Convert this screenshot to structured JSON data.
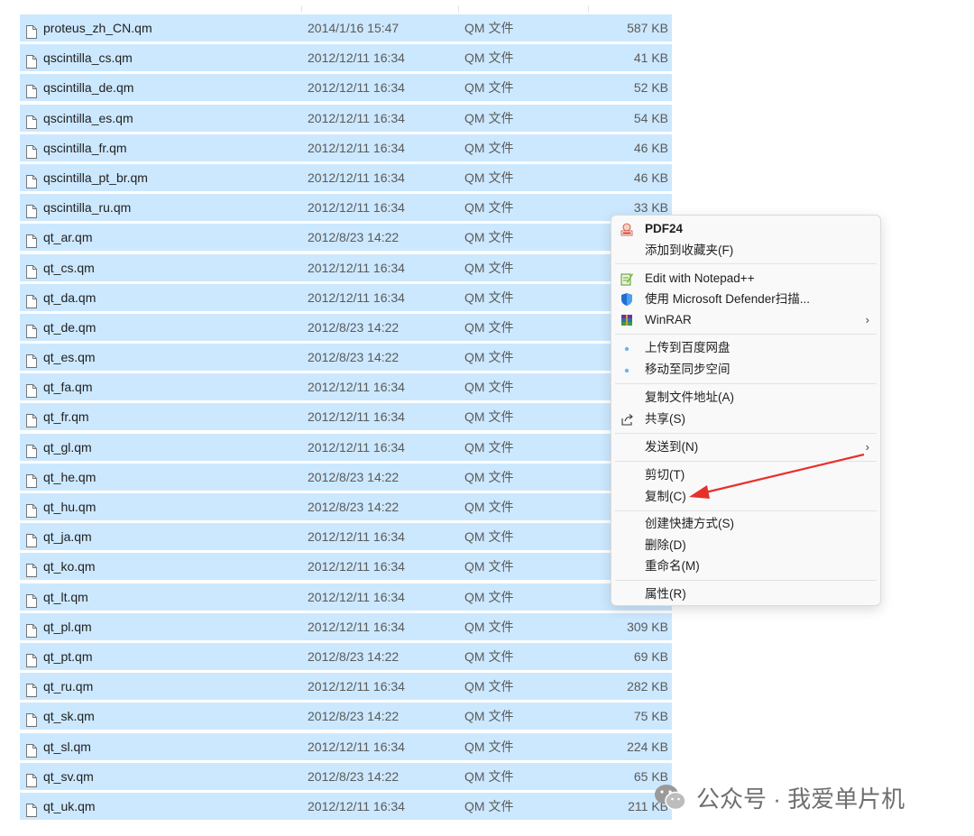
{
  "files": [
    {
      "name": "proteus_zh_CN.qm",
      "date": "2014/1/16 15:47",
      "type": "QM 文件",
      "size": "587 KB"
    },
    {
      "name": "qscintilla_cs.qm",
      "date": "2012/12/11 16:34",
      "type": "QM 文件",
      "size": "41 KB"
    },
    {
      "name": "qscintilla_de.qm",
      "date": "2012/12/11 16:34",
      "type": "QM 文件",
      "size": "52 KB"
    },
    {
      "name": "qscintilla_es.qm",
      "date": "2012/12/11 16:34",
      "type": "QM 文件",
      "size": "54 KB"
    },
    {
      "name": "qscintilla_fr.qm",
      "date": "2012/12/11 16:34",
      "type": "QM 文件",
      "size": "46 KB"
    },
    {
      "name": "qscintilla_pt_br.qm",
      "date": "2012/12/11 16:34",
      "type": "QM 文件",
      "size": "46 KB"
    },
    {
      "name": "qscintilla_ru.qm",
      "date": "2012/12/11 16:34",
      "type": "QM 文件",
      "size": "33 KB"
    },
    {
      "name": "qt_ar.qm",
      "date": "2012/8/23 14:22",
      "type": "QM 文件",
      "size": ""
    },
    {
      "name": "qt_cs.qm",
      "date": "2012/12/11 16:34",
      "type": "QM 文件",
      "size": ""
    },
    {
      "name": "qt_da.qm",
      "date": "2012/12/11 16:34",
      "type": "QM 文件",
      "size": ""
    },
    {
      "name": "qt_de.qm",
      "date": "2012/8/23 14:22",
      "type": "QM 文件",
      "size": ""
    },
    {
      "name": "qt_es.qm",
      "date": "2012/8/23 14:22",
      "type": "QM 文件",
      "size": ""
    },
    {
      "name": "qt_fa.qm",
      "date": "2012/12/11 16:34",
      "type": "QM 文件",
      "size": ""
    },
    {
      "name": "qt_fr.qm",
      "date": "2012/12/11 16:34",
      "type": "QM 文件",
      "size": ""
    },
    {
      "name": "qt_gl.qm",
      "date": "2012/12/11 16:34",
      "type": "QM 文件",
      "size": ""
    },
    {
      "name": "qt_he.qm",
      "date": "2012/8/23 14:22",
      "type": "QM 文件",
      "size": ""
    },
    {
      "name": "qt_hu.qm",
      "date": "2012/8/23 14:22",
      "type": "QM 文件",
      "size": ""
    },
    {
      "name": "qt_ja.qm",
      "date": "2012/12/11 16:34",
      "type": "QM 文件",
      "size": ""
    },
    {
      "name": "qt_ko.qm",
      "date": "2012/12/11 16:34",
      "type": "QM 文件",
      "size": ""
    },
    {
      "name": "qt_lt.qm",
      "date": "2012/12/11 16:34",
      "type": "QM 文件",
      "size": ""
    },
    {
      "name": "qt_pl.qm",
      "date": "2012/12/11 16:34",
      "type": "QM 文件",
      "size": "309 KB"
    },
    {
      "name": "qt_pt.qm",
      "date": "2012/8/23 14:22",
      "type": "QM 文件",
      "size": "69 KB"
    },
    {
      "name": "qt_ru.qm",
      "date": "2012/12/11 16:34",
      "type": "QM 文件",
      "size": "282 KB"
    },
    {
      "name": "qt_sk.qm",
      "date": "2012/8/23 14:22",
      "type": "QM 文件",
      "size": "75 KB"
    },
    {
      "name": "qt_sl.qm",
      "date": "2012/12/11 16:34",
      "type": "QM 文件",
      "size": "224 KB"
    },
    {
      "name": "qt_sv.qm",
      "date": "2012/8/23 14:22",
      "type": "QM 文件",
      "size": "65 KB"
    },
    {
      "name": "qt_uk.qm",
      "date": "2012/12/11 16:34",
      "type": "QM 文件",
      "size": "211 KB"
    }
  ],
  "context_menu": {
    "pdf24": "PDF24",
    "add_favorites": "添加到收藏夹(F)",
    "notepad": "Edit with Notepad++",
    "defender": "使用 Microsoft Defender扫描...",
    "winrar": "WinRAR",
    "baidu_upload": "上传到百度网盘",
    "sync_move": "移动至同步空间",
    "copy_path": "复制文件地址(A)",
    "share": "共享(S)",
    "send_to": "发送到(N)",
    "cut": "剪切(T)",
    "copy": "复制(C)",
    "create_shortcut": "创建快捷方式(S)",
    "delete": "删除(D)",
    "rename": "重命名(M)",
    "properties": "属性(R)"
  },
  "watermark": {
    "text": "公众号 · 我爱单片机"
  },
  "colors": {
    "selection": "#cce8ff",
    "annotation_arrow": "#e8302a"
  },
  "icons": {
    "file": "file-icon",
    "pdf24": "pdf24-icon",
    "notepad": "notepad-icon",
    "defender": "shield-icon",
    "winrar": "winrar-icon",
    "baidu": "cloud-icon",
    "share": "share-icon",
    "submenu": "chevron-right-icon",
    "wechat": "wechat-icon"
  }
}
